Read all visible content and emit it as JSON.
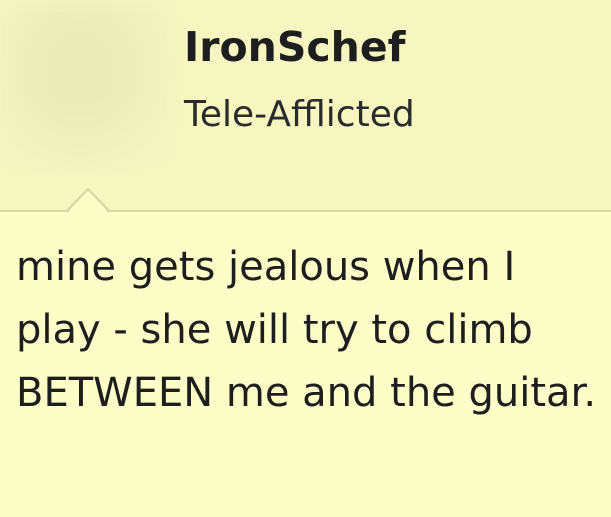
{
  "author": {
    "username": "IronSchef",
    "title": "Tele-Afflicted"
  },
  "post": {
    "message": "mine gets jealous when I play - she will try to climb BETWEEN me and the guitar."
  },
  "colors": {
    "header_bg": "#f6f6c0",
    "body_bg": "#fdfdc8",
    "border": "#d6d6a0",
    "text": "#1e1e1e"
  }
}
